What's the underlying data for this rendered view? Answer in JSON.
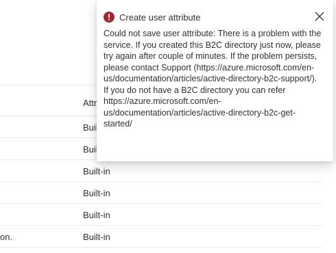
{
  "table": {
    "column_header": "Attribute type",
    "rows": [
      {
        "name": "",
        "type": "Built-in"
      },
      {
        "name": "",
        "type": "Built-in"
      },
      {
        "name": "",
        "type": "Built-in"
      },
      {
        "name": "",
        "type": "Built-in"
      },
      {
        "name": "",
        "type": "Built-in"
      },
      {
        "name": "on.",
        "type": "Built-in"
      }
    ]
  },
  "toast": {
    "title": "Create user attribute",
    "status": "error",
    "error_color": "#a4262c",
    "icon": "error-icon",
    "close_icon": "close-icon",
    "message_1": "Could not save user attribute: There is a problem with the service. If you created this B2C directory just now, please try again after couple of minutes. If the problem persists, please contact Support (https://azure.microsoft.com/en-us/documentation/articles/active-directory-b2c-support/).",
    "message_2": "If you do not have a B2C directory you can refer https://azure.microsoft.com/en-us/documentation/articles/active-directory-b2c-get-started/"
  }
}
